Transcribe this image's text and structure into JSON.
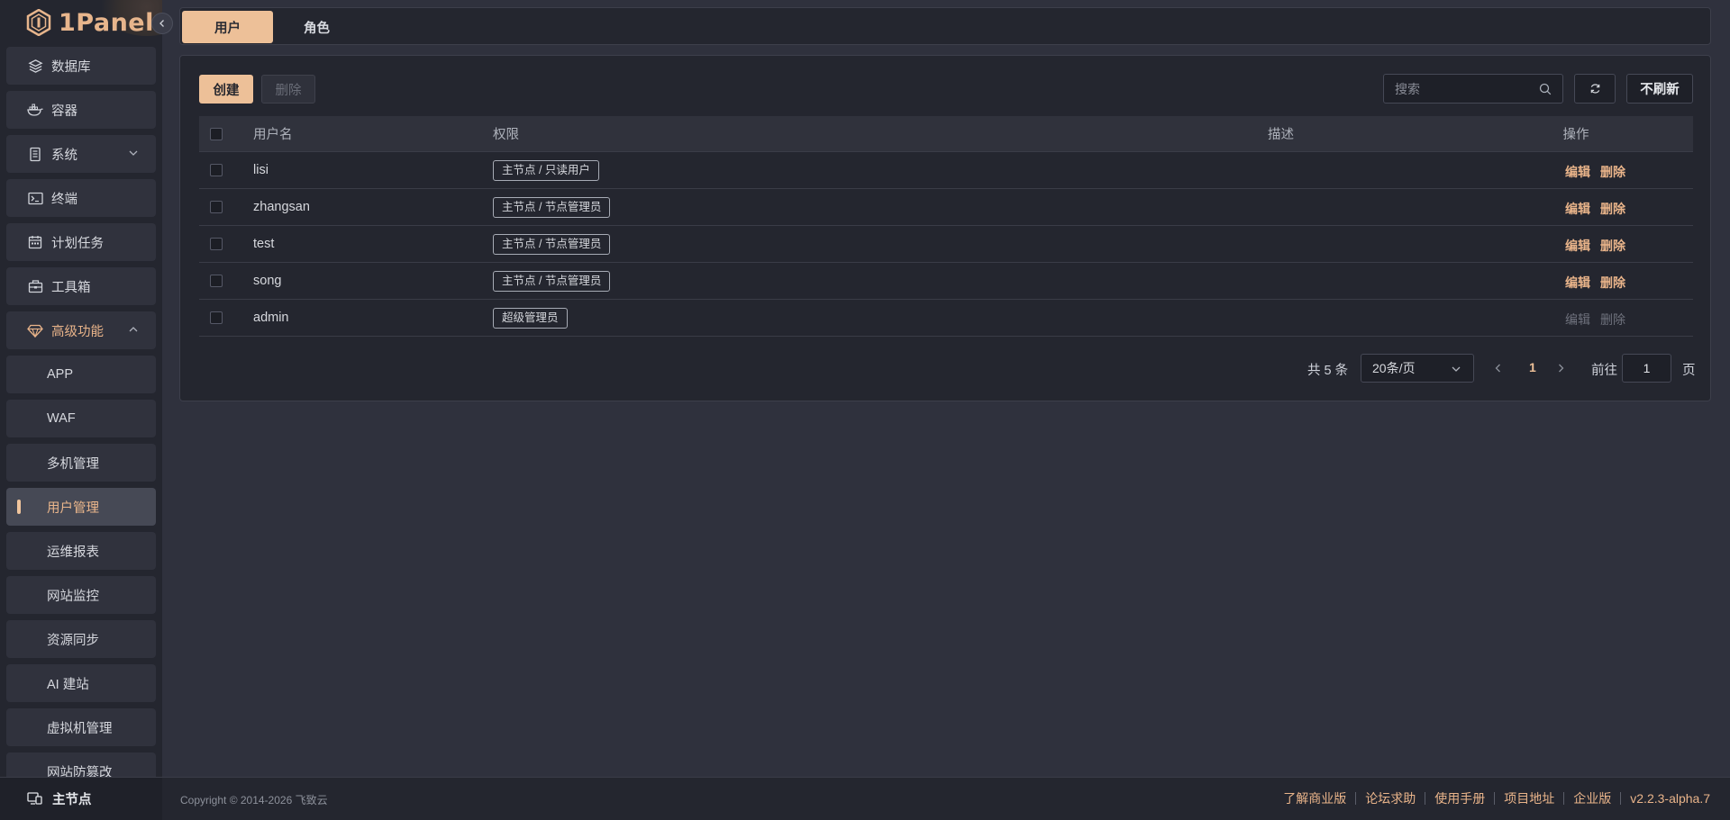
{
  "app": {
    "logo_text": "1Panel"
  },
  "sidebar": {
    "items": [
      {
        "label": "数据库",
        "icon": "layers-icon"
      },
      {
        "label": "容器",
        "icon": "docker-icon"
      },
      {
        "label": "系统",
        "icon": "server-icon",
        "expand": "collapsed"
      },
      {
        "label": "终端",
        "icon": "terminal-icon"
      },
      {
        "label": "计划任务",
        "icon": "calendar-icon"
      },
      {
        "label": "工具箱",
        "icon": "toolbox-icon"
      },
      {
        "label": "高级功能",
        "icon": "diamond-icon",
        "expand": "open"
      }
    ],
    "sub_items": [
      {
        "label": "APP"
      },
      {
        "label": "WAF"
      },
      {
        "label": "多机管理"
      },
      {
        "label": "用户管理",
        "active": true
      },
      {
        "label": "运维报表"
      },
      {
        "label": "网站监控"
      },
      {
        "label": "资源同步"
      },
      {
        "label": "AI 建站"
      },
      {
        "label": "虚拟机管理"
      },
      {
        "label": "网站防篡改"
      }
    ],
    "bottom": {
      "label": "主节点",
      "icon": "node-icon"
    }
  },
  "tabs": [
    {
      "label": "用户",
      "active": true
    },
    {
      "label": "角色",
      "active": false
    }
  ],
  "toolbar": {
    "create_label": "创建",
    "delete_label": "删除",
    "search_placeholder": "搜索",
    "norefresh_label": "不刷新"
  },
  "table": {
    "headers": {
      "username": "用户名",
      "permission": "权限",
      "description": "描述",
      "operations": "操作"
    },
    "rows": [
      {
        "username": "lisi",
        "permission": "主节点 / 只读用户",
        "description": "",
        "edit": "编辑",
        "delete": "删除",
        "disabled": false
      },
      {
        "username": "zhangsan",
        "permission": "主节点 / 节点管理员",
        "description": "",
        "edit": "编辑",
        "delete": "删除",
        "disabled": false
      },
      {
        "username": "test",
        "permission": "主节点 / 节点管理员",
        "description": "",
        "edit": "编辑",
        "delete": "删除",
        "disabled": false
      },
      {
        "username": "song",
        "permission": "主节点 / 节点管理员",
        "description": "",
        "edit": "编辑",
        "delete": "删除",
        "disabled": false
      },
      {
        "username": "admin",
        "permission": "超级管理员",
        "description": "",
        "edit": "编辑",
        "delete": "删除",
        "disabled": true
      }
    ]
  },
  "pagination": {
    "total_text": "共 5 条",
    "page_size": "20条/页",
    "current_page": "1",
    "goto_label": "前往",
    "goto_value": "1",
    "page_suffix": "页"
  },
  "footer": {
    "copyright": "Copyright © 2014-2026 飞致云",
    "links": [
      "了解商业版",
      "论坛求助",
      "使用手册",
      "项目地址"
    ],
    "edition": "企业版",
    "version": "v2.2.3-alpha.7"
  },
  "colors": {
    "accent": "#edc098",
    "link": "#e9b48a",
    "bg": "#2f313d",
    "panel": "#24262f"
  }
}
